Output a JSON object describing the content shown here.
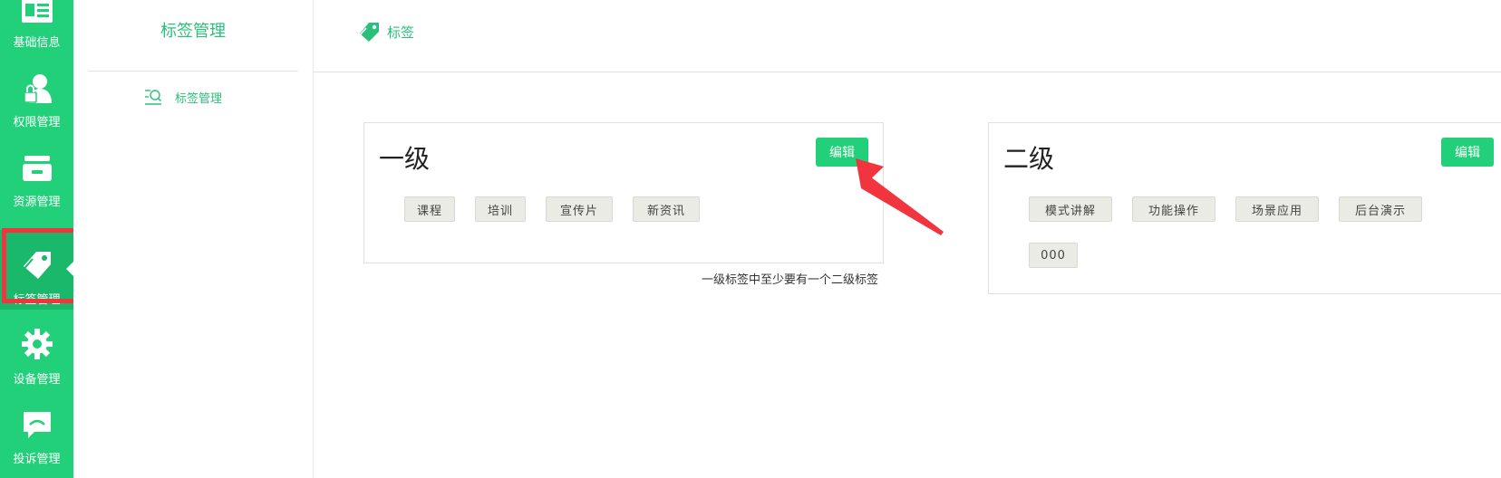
{
  "rail": {
    "items": [
      {
        "label": "基础信息",
        "icon": "id-card-icon"
      },
      {
        "label": "权限管理",
        "icon": "user-lock-icon"
      },
      {
        "label": "资源管理",
        "icon": "archive-box-icon"
      },
      {
        "label": "标签管理",
        "icon": "tags-icon"
      },
      {
        "label": "设备管理",
        "icon": "gear-icon"
      },
      {
        "label": "投诉管理",
        "icon": "chat-bubble-icon"
      }
    ],
    "active_index": 3
  },
  "subnav": {
    "title": "标签管理",
    "items": [
      {
        "label": "标签管理",
        "icon": "list-search-icon"
      }
    ]
  },
  "header": {
    "breadcrumb": "标签",
    "icon": "tag-icon"
  },
  "level1": {
    "title": "一级",
    "edit_label": "编辑",
    "tags": [
      "课程",
      "培训",
      "宣传片",
      "新资讯"
    ],
    "hint": "一级标签中至少要有一个二级标签"
  },
  "level2": {
    "title": "二级",
    "edit_label": "编辑",
    "tags": [
      "模式讲解",
      "功能操作",
      "场景应用",
      "后台演示",
      "000"
    ]
  },
  "colors": {
    "brand": "#22d07a",
    "brand_dark": "#19b86a",
    "annotation_red": "#f0353e",
    "tag_bg": "#ebebe6"
  }
}
